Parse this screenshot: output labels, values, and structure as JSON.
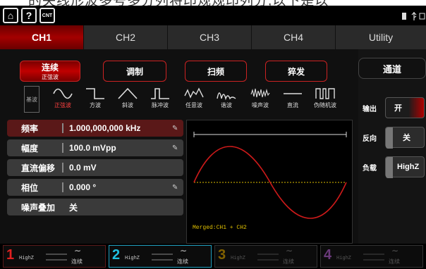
{
  "banner": {
    "text": "的失线形波多号多分列将印规规印列分,以下是以"
  },
  "topbar": {
    "home_glyph": "⌂",
    "help_glyph": "?",
    "cnt_glyph": "CNT"
  },
  "tabs": [
    "CH1",
    "CH2",
    "CH3",
    "CH4",
    "Utility"
  ],
  "modes": [
    {
      "label": "连续",
      "sub": "正弦波",
      "selected": true
    },
    {
      "label": "调制"
    },
    {
      "label": "扫频"
    },
    {
      "label": "猝发"
    }
  ],
  "wave_side": "基波",
  "waves": [
    {
      "label": "正弦波",
      "icon": "sine-icon"
    },
    {
      "label": "方波",
      "icon": "square-icon"
    },
    {
      "label": "斜波",
      "icon": "ramp-icon"
    },
    {
      "label": "脉冲波",
      "icon": "pulse-icon"
    },
    {
      "label": "任意波",
      "icon": "arb-icon"
    },
    {
      "label": "谐波",
      "icon": "harmonic-icon"
    },
    {
      "label": "噪声波",
      "icon": "noise-icon"
    },
    {
      "label": "直流",
      "icon": "dc-icon"
    },
    {
      "label": "伪随机波",
      "icon": "prbs-icon"
    }
  ],
  "params": [
    {
      "label": "频率",
      "value": "1.000,000,000 kHz",
      "editable": true
    },
    {
      "label": "幅度",
      "value": "100.0 mVpp",
      "editable": true
    },
    {
      "label": "直流偏移",
      "value": "0.0 mV",
      "editable": false
    },
    {
      "label": "相位",
      "value": "0.000 °",
      "editable": true
    },
    {
      "label": "噪声叠加",
      "value": "关",
      "editable": false
    }
  ],
  "graph": {
    "merged": "Merged:CH1 + CH2"
  },
  "channel": {
    "title": "通道",
    "output_label": "输出",
    "output_value": "开",
    "invert_label": "反向",
    "invert_value": "关",
    "load_label": "负载",
    "load_value": "HighZ"
  },
  "bottom_channels": [
    {
      "num": "1",
      "z": "HighZ",
      "label": "连续",
      "color": "#e02020"
    },
    {
      "num": "2",
      "z": "HighZ",
      "label": "连续",
      "color": "#20c0e0"
    },
    {
      "num": "3",
      "z": "HighZ",
      "label": "连续",
      "color": "#806000"
    },
    {
      "num": "4",
      "z": "HighZ",
      "label": "连续",
      "color": "#6a3a7a"
    }
  ]
}
